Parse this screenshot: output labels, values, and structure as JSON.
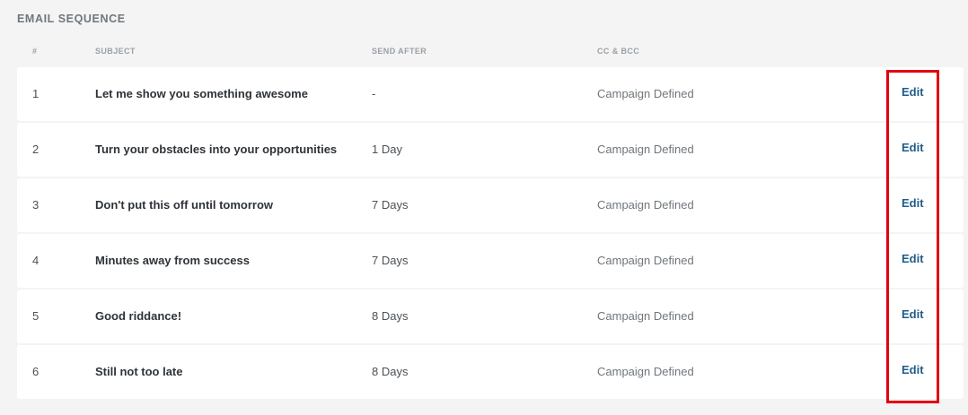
{
  "section": {
    "title": "EMAIL SEQUENCE"
  },
  "columns": {
    "number": "#",
    "subject": "SUBJECT",
    "send_after": "SEND AFTER",
    "cc_bcc": "CC & BCC"
  },
  "rows": [
    {
      "number": "1",
      "subject": "Let me show you something awesome",
      "send_after": "-",
      "cc_bcc": "Campaign Defined",
      "action": "Edit"
    },
    {
      "number": "2",
      "subject": "Turn your obstacles into your opportunities",
      "send_after": "1 Day",
      "cc_bcc": "Campaign Defined",
      "action": "Edit"
    },
    {
      "number": "3",
      "subject": "Don't put this off until tomorrow",
      "send_after": "7 Days",
      "cc_bcc": "Campaign Defined",
      "action": "Edit"
    },
    {
      "number": "4",
      "subject": "Minutes away from success",
      "send_after": "7 Days",
      "cc_bcc": "Campaign Defined",
      "action": "Edit"
    },
    {
      "number": "5",
      "subject": "Good riddance!",
      "send_after": "8 Days",
      "cc_bcc": "Campaign Defined",
      "action": "Edit"
    },
    {
      "number": "6",
      "subject": "Still not too late",
      "send_after": "8 Days",
      "cc_bcc": "Campaign Defined",
      "action": "Edit"
    }
  ],
  "colors": {
    "background": "#f4f4f4",
    "row_background": "#ffffff",
    "edit_link": "#1f5d8a",
    "highlight": "#e3000f"
  }
}
